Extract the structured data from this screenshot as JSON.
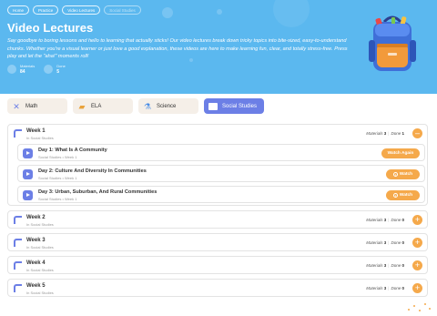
{
  "breadcrumb": [
    "Home",
    "Practice",
    "Video Lectures",
    "Social Studies"
  ],
  "page": {
    "title": "Video Lectures",
    "description": "Say goodbye to boring lessons and hello to learning that actually sticks! Our video lectures break down tricky topics into bite-sized, easy-to-understand chunks. Whether you're a visual learner or just love a good explanation, these videos are here to make learning fun, clear, and totally stress-free. Press play and let the \"aha!\" moments roll!"
  },
  "stats": [
    {
      "label": "Materials",
      "value": "84",
      "icon": "book-icon"
    },
    {
      "label": "Done",
      "value": "5",
      "icon": "check-icon"
    }
  ],
  "subjects": [
    {
      "label": "Math",
      "icon": "math-icon",
      "active": false
    },
    {
      "label": "ELA",
      "icon": "ela-icon",
      "active": false
    },
    {
      "label": "Science",
      "icon": "science-icon",
      "active": false
    },
    {
      "label": "Social Studies",
      "icon": "social-studies-icon",
      "active": true
    }
  ],
  "labels": {
    "materials": "Materials",
    "done": "Done",
    "watch_again": "Watch Again",
    "watch": "Watch"
  },
  "weeks": [
    {
      "title": "Week 1",
      "subtitle": "In Social Studies",
      "materials": "3",
      "done": "1",
      "expanded": true,
      "toggle": "–"
    },
    {
      "title": "Week 2",
      "subtitle": "In Social Studies",
      "materials": "3",
      "done": "0",
      "expanded": false,
      "toggle": "+"
    },
    {
      "title": "Week 3",
      "subtitle": "In Social Studies",
      "materials": "3",
      "done": "0",
      "expanded": false,
      "toggle": "+"
    },
    {
      "title": "Week 4",
      "subtitle": "In Social Studies",
      "materials": "3",
      "done": "0",
      "expanded": false,
      "toggle": "+"
    },
    {
      "title": "Week 5",
      "subtitle": "In Social Studies",
      "materials": "3",
      "done": "0",
      "expanded": false,
      "toggle": "+"
    }
  ],
  "lessons": [
    {
      "title": "Day 1: What Is A Community",
      "subtitle": "Social Studies • Week 1",
      "action": "Watch Again"
    },
    {
      "title": "Day 2: Culture And Diversity In Communities",
      "subtitle": "Social Studies • Week 1",
      "action": "Watch"
    },
    {
      "title": "Day 3: Urban, Suburban, And Rural Communities",
      "subtitle": "Social Studies • Week 1",
      "action": "Watch"
    }
  ],
  "colors": {
    "hero": "#5bb8ef",
    "accent": "#6c7fe6",
    "button": "#f5a94b"
  }
}
